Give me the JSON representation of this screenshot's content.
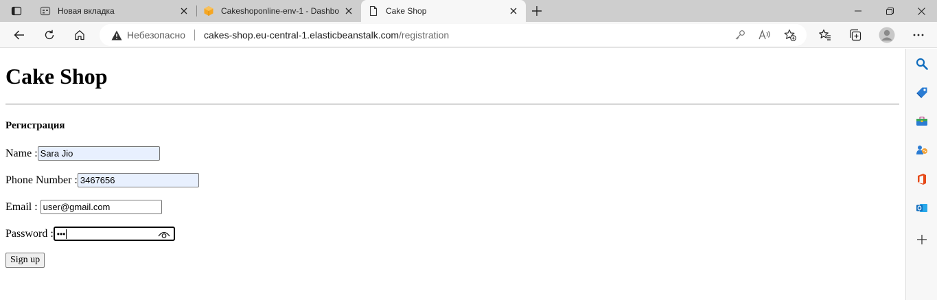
{
  "browser": {
    "tabs": [
      {
        "title": "Новая вкладка",
        "icon": "new-tab-page-icon"
      },
      {
        "title": "Cakeshoponline-env-1 - Dashbo",
        "icon": "aws-box-icon"
      },
      {
        "title": "Cake Shop",
        "icon": "document-icon",
        "active": true
      }
    ],
    "address": {
      "security_label": "Небезопасно",
      "url_host": "cakes-shop.eu-central-1.elasticbeanstalk.com",
      "url_path": "/registration"
    },
    "colors": {
      "tabstrip": "#cecece",
      "toolbar": "#f7f7f7",
      "accent": "#0f6cbd"
    }
  },
  "page": {
    "title": "Cake Shop",
    "subtitle": "Регистрация",
    "fields": {
      "name": {
        "label": "Name :",
        "value": "Sara Jio"
      },
      "phone": {
        "label": "Phone Number :",
        "value": "3467656"
      },
      "email": {
        "label": "Email : ",
        "value": "user@gmail.com"
      },
      "password": {
        "label": "Password :",
        "value": "•••"
      }
    },
    "submit_label": "Sign up"
  }
}
